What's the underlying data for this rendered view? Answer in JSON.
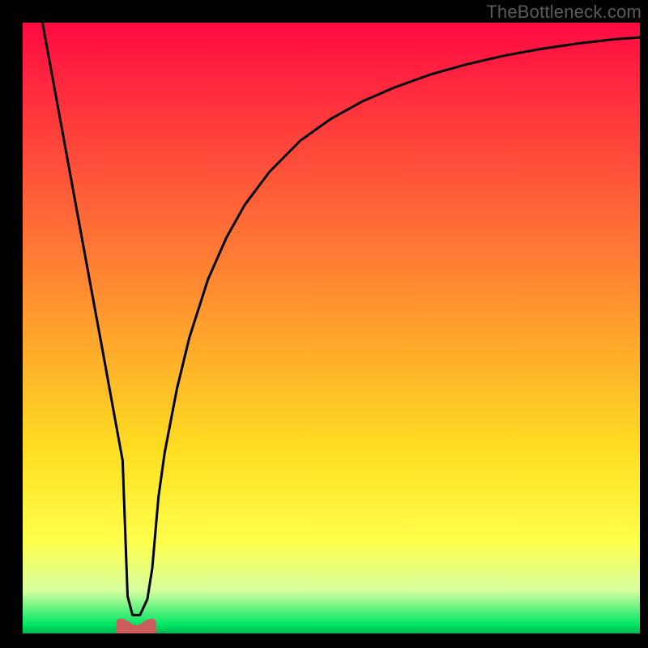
{
  "watermark": "TheBottleneck.com",
  "chart_data": {
    "type": "line",
    "title": "",
    "xlabel": "",
    "ylabel": "",
    "xlim": [
      0,
      100
    ],
    "ylim": [
      0,
      100
    ],
    "grid": false,
    "series": [
      {
        "name": "bottleneck-curve",
        "color": "#000000",
        "x": [
          3.2,
          5,
          7,
          9,
          11,
          13,
          15,
          16.2,
          17,
          17.8,
          19,
          20.2,
          21,
          22,
          23,
          25,
          27,
          30,
          33,
          36,
          40,
          45,
          50,
          55,
          60,
          66,
          72,
          78,
          84,
          90,
          96,
          100
        ],
        "y": [
          100,
          90.1,
          79.1,
          68.0,
          57.0,
          46.0,
          34.9,
          28.3,
          6.1,
          3.0,
          3.0,
          5.6,
          10.7,
          22.3,
          29.6,
          40.1,
          48.4,
          57.9,
          64.8,
          70.2,
          75.6,
          80.7,
          84.3,
          87.1,
          89.3,
          91.5,
          93.2,
          94.6,
          95.7,
          96.6,
          97.3,
          97.6
        ]
      }
    ],
    "marker": {
      "name": "optimum-marker",
      "color": "#cd5c5c",
      "x_center": 18.4,
      "width": 3.2,
      "height": 2.0
    },
    "background": {
      "type": "vertical-gradient",
      "stops": [
        {
          "pos": 0.0,
          "color": "#ff0a42"
        },
        {
          "pos": 0.4,
          "color": "#ff8133"
        },
        {
          "pos": 0.7,
          "color": "#fede21"
        },
        {
          "pos": 0.85,
          "color": "#ffff4b"
        },
        {
          "pos": 0.93,
          "color": "#d7ffa0"
        },
        {
          "pos": 0.985,
          "color": "#00e765"
        },
        {
          "pos": 1.0,
          "color": "#00b84f"
        }
      ]
    }
  }
}
